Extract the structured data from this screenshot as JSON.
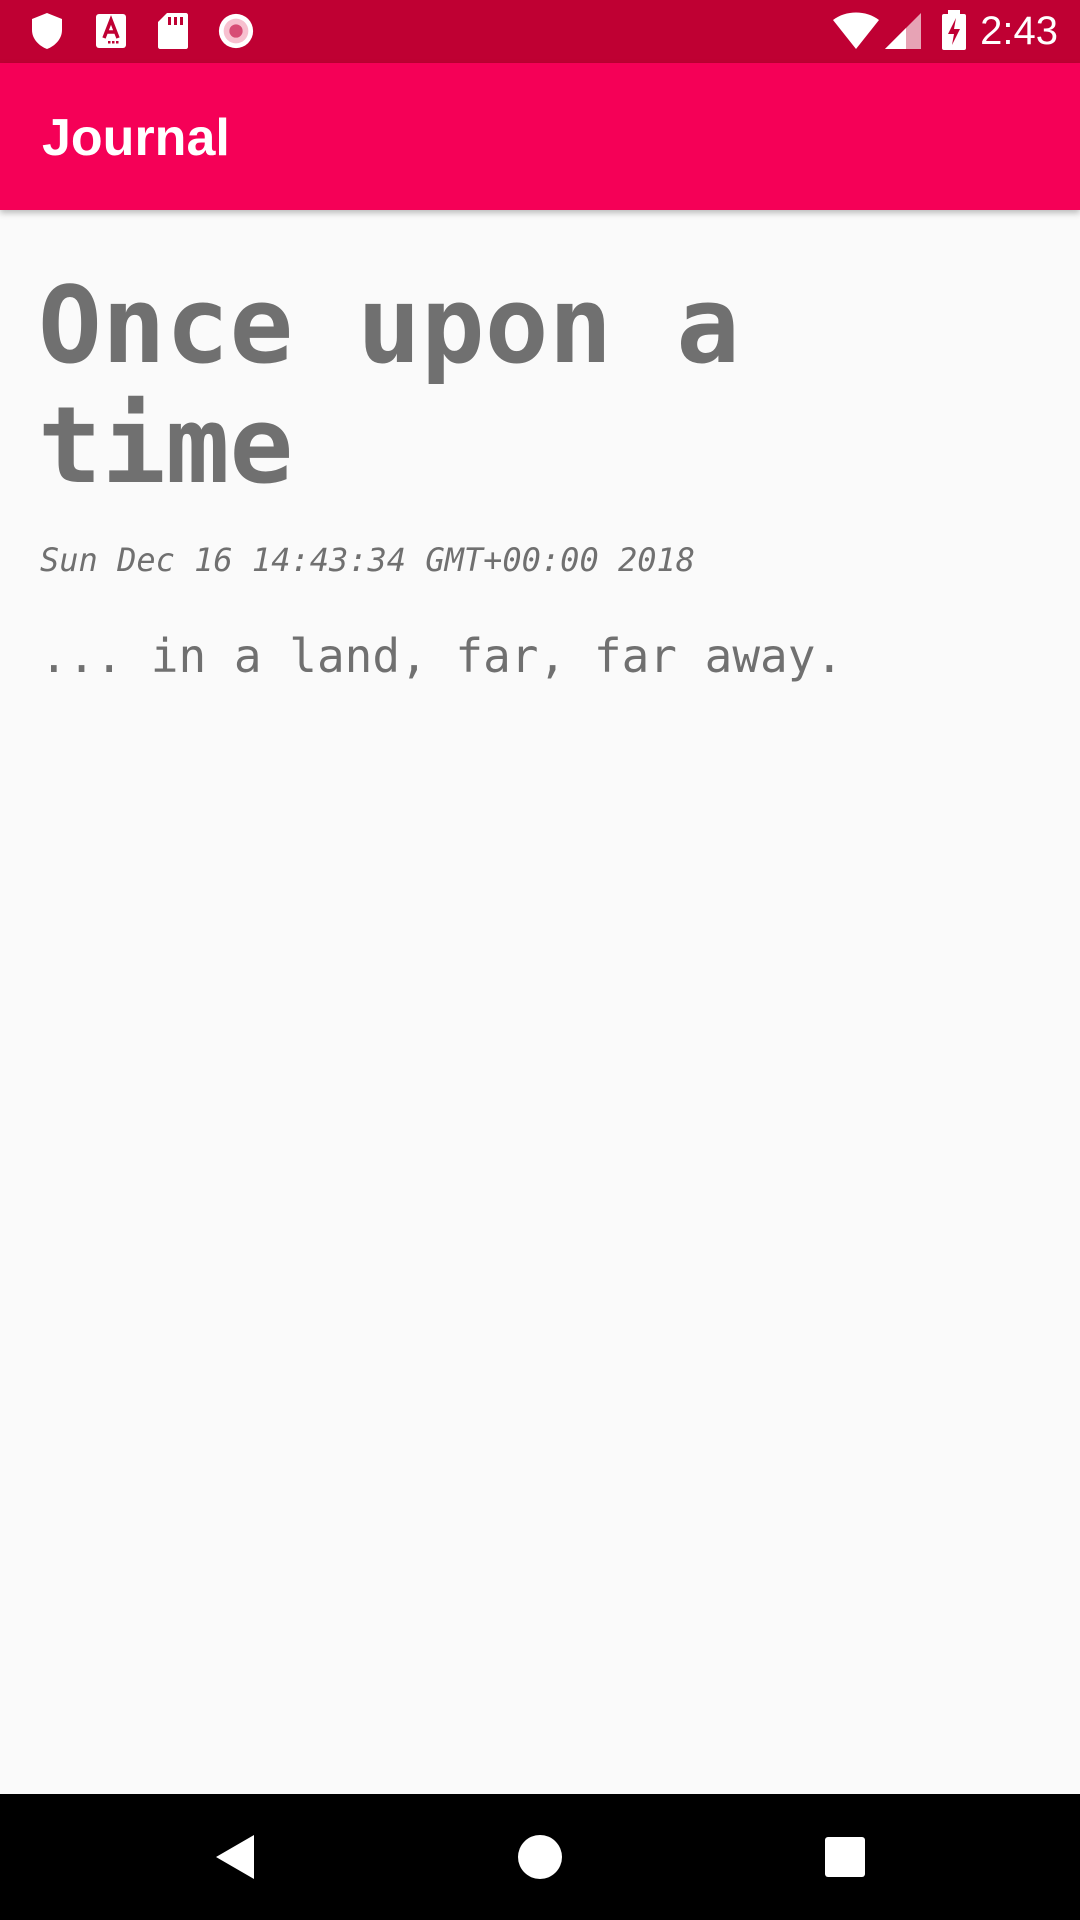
{
  "status_bar": {
    "time": "2:43",
    "icons_left": [
      "shield-icon",
      "font-a-icon",
      "sd-card-icon",
      "record-icon"
    ],
    "icons_right": [
      "wifi-icon",
      "cell-signal-icon",
      "battery-charging-icon"
    ],
    "color": "#bf0033"
  },
  "app_bar": {
    "title": "Journal",
    "color": "#f50057"
  },
  "entry": {
    "title": "Once upon a time",
    "date": "Sun Dec 16 14:43:34 GMT+00:00 2018",
    "body": "... in a land, far, far away."
  },
  "nav_bar": {
    "buttons": [
      "back-icon",
      "home-icon",
      "recents-icon"
    ]
  }
}
